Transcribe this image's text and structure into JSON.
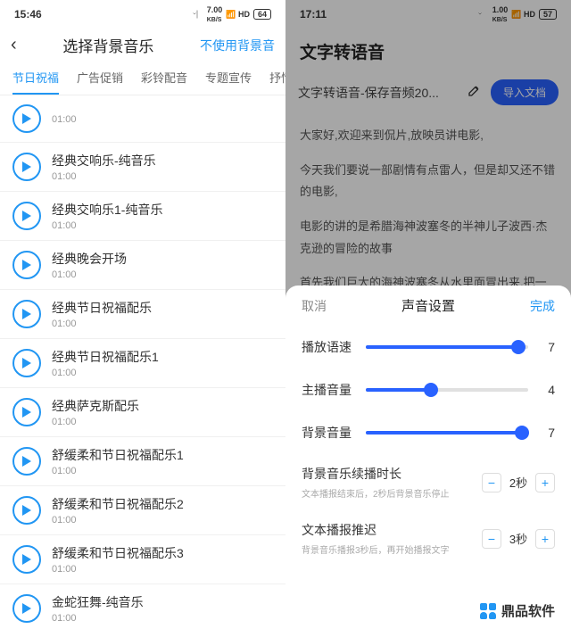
{
  "left": {
    "status": {
      "time": "15:46",
      "net": "7.00",
      "netUnit": "KB/S",
      "battery": "64"
    },
    "header": {
      "title": "选择背景音乐",
      "action": "不使用背景音"
    },
    "tabs": [
      "节日祝福",
      "广告促销",
      "彩铃配音",
      "专题宣传",
      "抒情叫"
    ],
    "activeTab": 0,
    "items": [
      {
        "title": " ",
        "dur": "01:00"
      },
      {
        "title": "经典交响乐-纯音乐",
        "dur": "01:00"
      },
      {
        "title": "经典交响乐1-纯音乐",
        "dur": "01:00"
      },
      {
        "title": "经典晚会开场",
        "dur": "01:00"
      },
      {
        "title": "经典节日祝福配乐",
        "dur": "01:00"
      },
      {
        "title": "经典节日祝福配乐1",
        "dur": "01:00"
      },
      {
        "title": "经典萨克斯配乐",
        "dur": "01:00"
      },
      {
        "title": "舒缓柔和节日祝福配乐1",
        "dur": "01:00"
      },
      {
        "title": "舒缓柔和节日祝福配乐2",
        "dur": "01:00"
      },
      {
        "title": "舒缓柔和节日祝福配乐3",
        "dur": "01:00"
      },
      {
        "title": "金蛇狂舞-纯音乐",
        "dur": "01:00"
      }
    ]
  },
  "right": {
    "status": {
      "time": "17:11",
      "net": "1.00",
      "netUnit": "KB/S",
      "battery": "57"
    },
    "title": "文字转语音",
    "docName": "文字转语音-保存音频20...",
    "importBtn": "导入文档",
    "body": [
      "大家好,欢迎来到侃片,放映员讲电影,",
      "今天我们要说一部剧情有点雷人，但是却又还不错的电影,",
      "电影的讲的是希腊海神波塞冬的半神儿子波西·杰克逊的冒险的故事",
      "首先我们巨大的海神波塞冬从水里面冒出来,把一"
    ],
    "sheet": {
      "cancel": "取消",
      "title": "声音设置",
      "done": "完成",
      "sliders": [
        {
          "label": "播放语速",
          "value": 7,
          "max": 10,
          "pct": 94
        },
        {
          "label": "主播音量",
          "value": 4,
          "max": 10,
          "pct": 40
        },
        {
          "label": "背景音量",
          "value": 7,
          "max": 10,
          "pct": 96
        }
      ],
      "settings": [
        {
          "name": "背景音乐续播时长",
          "desc": "文本播报结束后，2秒后背景音乐停止",
          "val": "2秒"
        },
        {
          "name": "文本播报推迟",
          "desc": "背景音乐播报3秒后，再开始播报文字",
          "val": "3秒"
        }
      ]
    }
  },
  "watermark": "鼎品软件"
}
